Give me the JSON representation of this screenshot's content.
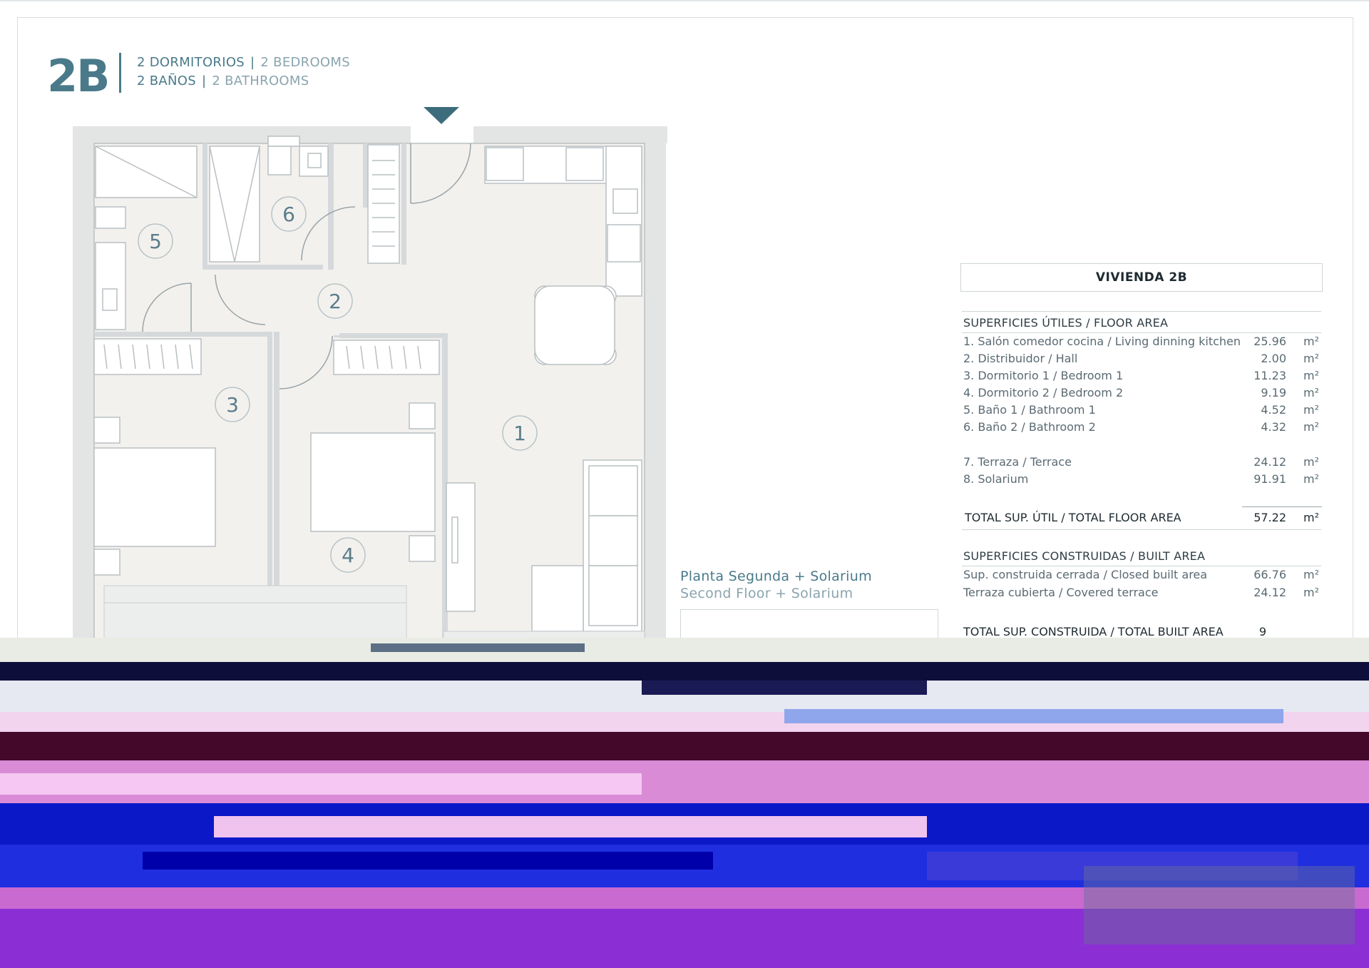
{
  "header": {
    "unit_code": "2B",
    "line1_es": "2 DORMITORIOS",
    "line1_en": "2 BEDROOMS",
    "line2_es": "2 BAÑOS",
    "line2_en": "2 BATHROOMS",
    "separator": "|"
  },
  "plan": {
    "room_numbers": [
      "1",
      "2",
      "3",
      "4",
      "5",
      "6"
    ],
    "floor_label_es": "Planta Segunda + Solarium",
    "floor_label_en": "Second Floor + Solarium"
  },
  "table": {
    "title": "VIVIENDA 2B",
    "useful_header": "SUPERFICIES ÚTILES / FLOOR AREA",
    "useful_rows": [
      {
        "label": "1. Salón comedor cocina / Living dinning kitchen",
        "value": "25.96",
        "unit": "m²"
      },
      {
        "label": "2. Distribuidor / Hall",
        "value": "2.00",
        "unit": "m²"
      },
      {
        "label": "3. Dormitorio 1 / Bedroom 1",
        "value": "11.23",
        "unit": "m²"
      },
      {
        "label": "4. Dormitorio 2 / Bedroom 2",
        "value": "9.19",
        "unit": "m²"
      },
      {
        "label": "5. Baño 1 / Bathroom 1",
        "value": "4.52",
        "unit": "m²"
      },
      {
        "label": "6. Baño 2 / Bathroom 2",
        "value": "4.32",
        "unit": "m²"
      }
    ],
    "outdoor_rows": [
      {
        "label": "7. Terraza / Terrace",
        "value": "24.12",
        "unit": "m²"
      },
      {
        "label": "8. Solarium",
        "value": "91.91",
        "unit": "m²"
      }
    ],
    "total_useful": {
      "label": "TOTAL SUP. ÚTIL / TOTAL FLOOR AREA",
      "value": "57.22",
      "unit": "m²"
    },
    "built_header": "SUPERFICIES CONSTRUIDAS / BUILT AREA",
    "built_rows": [
      {
        "label": "Sup. construida cerrada / Closed built area",
        "value": "66.76",
        "unit": "m²"
      },
      {
        "label": "Terraza cubierta / Covered terrace",
        "value": "24.12",
        "unit": "m²"
      }
    ],
    "total_built": {
      "label": "TOTAL SUP. CONSTRUIDA /  TOTAL BUILT AREA",
      "value": "9",
      "unit": ""
    }
  },
  "colors": {
    "accent": "#4a7a8a",
    "accent_light": "#8aa4ae",
    "wall": "#e3e5e4",
    "floor_fill": "#f3f1ee"
  }
}
